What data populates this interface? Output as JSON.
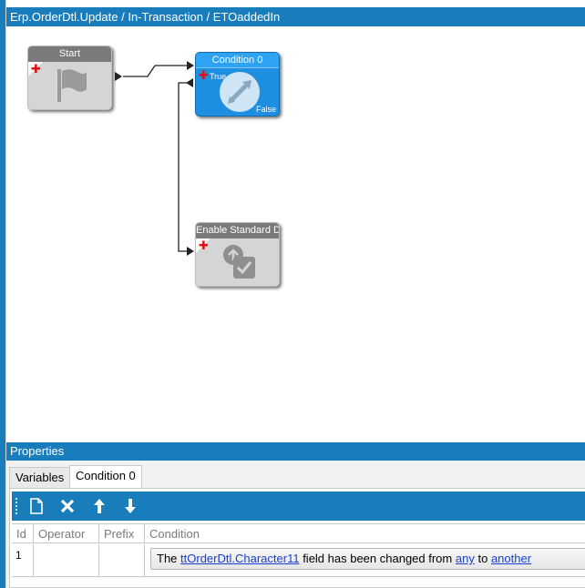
{
  "window": {
    "breadcrumb": "Erp.OrderDtl.Update / In-Transaction / ETOaddedIn"
  },
  "workflow": {
    "nodes": {
      "start": {
        "title": "Start",
        "icon": "flag-icon"
      },
      "condition": {
        "title": "Condition 0",
        "true_label": "True",
        "false_label": "False",
        "icon": "condition-arrows-icon"
      },
      "enable": {
        "title": "Enable Standard D",
        "icon": "enable-standard-icon"
      }
    }
  },
  "properties": {
    "header": "Properties",
    "tabs": [
      "Variables",
      "Condition 0"
    ],
    "active_tab": "Condition 0",
    "toolbar": [
      "new-icon",
      "delete-icon",
      "move-up-icon",
      "move-down-icon"
    ],
    "grid": {
      "columns": [
        "Id",
        "Operator",
        "Prefix",
        "Condition"
      ],
      "rows": [
        {
          "id": "1",
          "operator": "",
          "prefix": "",
          "condition": {
            "text_the": "The",
            "field_link": "ttOrderDtl.Character11",
            "text_changed": "field has been changed from",
            "from_link": "any",
            "text_to": "to",
            "to_link": "another"
          }
        }
      ]
    }
  },
  "colors": {
    "accent": "#1a7dbb",
    "condition_node": "#1e8fe0",
    "node_gray": "#d5d5d5",
    "link": "#1a3fd0",
    "plus": "#e01010"
  }
}
